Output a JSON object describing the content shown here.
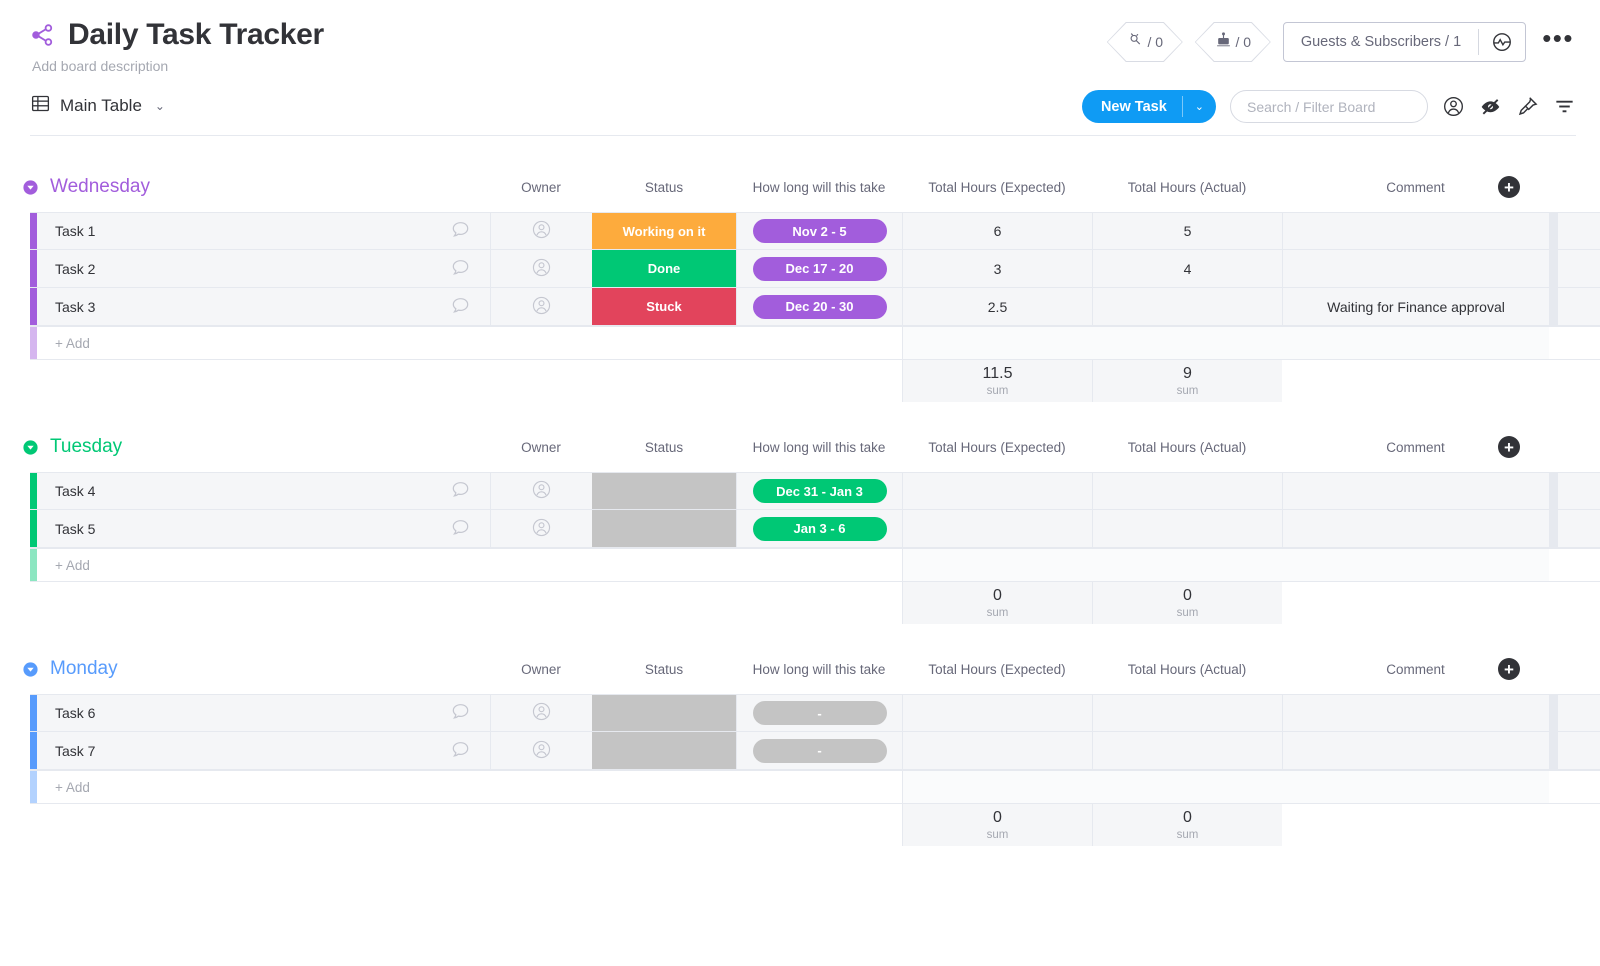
{
  "header": {
    "share_icon": "share-icon",
    "title": "Daily Task Tracker",
    "description_placeholder": "Add board description",
    "badges": [
      {
        "icon": "integrations-icon",
        "label": "/ 0"
      },
      {
        "icon": "automations-robot-icon",
        "label": "/ 0"
      }
    ],
    "guests": {
      "label": "Guests & Subscribers / 1",
      "icon": "activity-globe-icon"
    },
    "more_label": "•••"
  },
  "toolbar": {
    "view_icon": "table-icon",
    "view_label": "Main Table",
    "view_chevron": "⌄",
    "new_task_label": "New Task",
    "new_task_arrow": "⌄",
    "search_placeholder": "Search / Filter Board",
    "search_value": "",
    "icons": [
      {
        "name": "person-icon"
      },
      {
        "name": "hide-eye-slash-icon"
      },
      {
        "name": "pin-icon"
      },
      {
        "name": "sort-filter-icon"
      }
    ]
  },
  "columns": {
    "owner": "Owner",
    "status": "Status",
    "timeline": "How long will this take",
    "expected": "Total Hours (Expected)",
    "actual": "Total Hours (Actual)",
    "comment": "Comment",
    "add_column": "+"
  },
  "add_row_label": "+ Add",
  "sum_label": "sum",
  "colors": {
    "wednesday": "#a25ddc",
    "tuesday": "#00c875",
    "monday": "#579bfc",
    "status_working": "#fdab3d",
    "status_done": "#00c875",
    "status_stuck": "#e2445c",
    "status_empty": "#c4c4c4",
    "timeline_purple": "#a25ddc",
    "timeline_green": "#00c875",
    "timeline_empty": "#c4c4c4",
    "accent_blue": "#0f9bf4"
  },
  "groups": [
    {
      "name": "Wednesday",
      "color": "#a25ddc",
      "tasks": [
        {
          "name": "Task 1",
          "status": "Working on it",
          "status_color": "#fdab3d",
          "timeline": "Nov 2 - 5",
          "timeline_color": "#a25ddc",
          "expected": "6",
          "actual": "5",
          "comment": ""
        },
        {
          "name": "Task 2",
          "status": "Done",
          "status_color": "#00c875",
          "timeline": "Dec 17 - 20",
          "timeline_color": "#a25ddc",
          "expected": "3",
          "actual": "4",
          "comment": ""
        },
        {
          "name": "Task 3",
          "status": "Stuck",
          "status_color": "#e2445c",
          "timeline": "Dec 20 - 30",
          "timeline_color": "#a25ddc",
          "expected": "2.5",
          "actual": "",
          "comment": "Waiting for Finance approval"
        }
      ],
      "sum_expected": "11.5",
      "sum_actual": "9"
    },
    {
      "name": "Tuesday",
      "color": "#00c875",
      "tasks": [
        {
          "name": "Task 4",
          "status": "",
          "status_color": "#c4c4c4",
          "timeline": "Dec 31 - Jan 3",
          "timeline_color": "#00c875",
          "expected": "",
          "actual": "",
          "comment": ""
        },
        {
          "name": "Task 5",
          "status": "",
          "status_color": "#c4c4c4",
          "timeline": "Jan 3 - 6",
          "timeline_color": "#00c875",
          "expected": "",
          "actual": "",
          "comment": ""
        }
      ],
      "sum_expected": "0",
      "sum_actual": "0"
    },
    {
      "name": "Monday",
      "color": "#579bfc",
      "tasks": [
        {
          "name": "Task 6",
          "status": "",
          "status_color": "#c4c4c4",
          "timeline": "-",
          "timeline_color": "#c4c4c4",
          "expected": "",
          "actual": "",
          "comment": ""
        },
        {
          "name": "Task 7",
          "status": "",
          "status_color": "#c4c4c4",
          "timeline": "-",
          "timeline_color": "#c4c4c4",
          "expected": "",
          "actual": "",
          "comment": ""
        }
      ],
      "sum_expected": "0",
      "sum_actual": "0"
    }
  ]
}
